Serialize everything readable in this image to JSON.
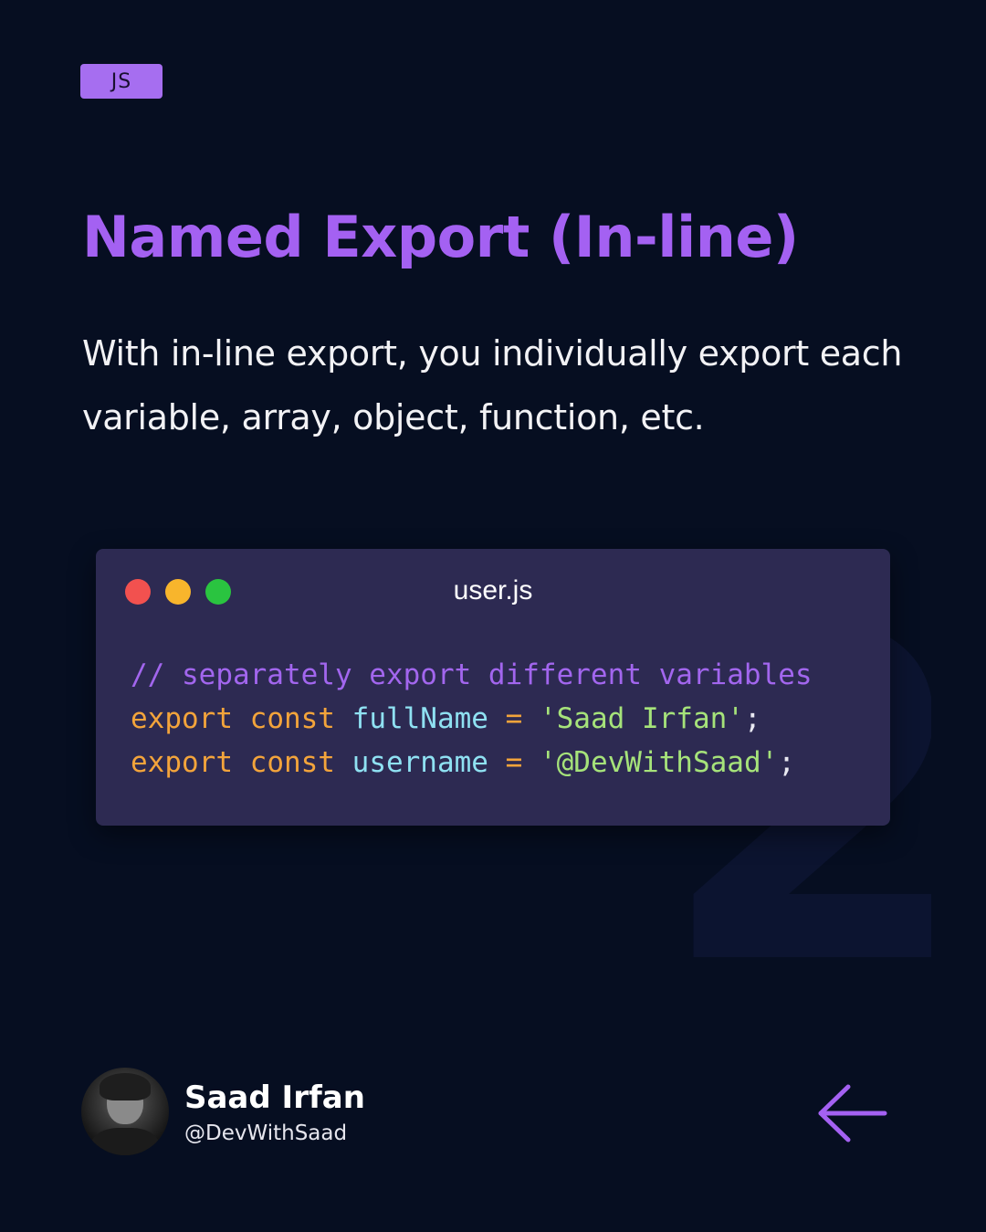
{
  "badge": {
    "label": "JS"
  },
  "title": "Named Export (In-line)",
  "description": "With in-line export, you individually export each variable, array, object, function, etc.",
  "background_number": "2",
  "code_window": {
    "filename": "user.js",
    "lines": {
      "line1": {
        "comment": "// separately export different variables"
      },
      "line2": {
        "kw_export": "export",
        "kw_const": "const",
        "identifier": "fullName",
        "operator": "=",
        "string": "'Saad Irfan'",
        "terminator": ";"
      },
      "line3": {
        "kw_export": "export",
        "kw_const": "const",
        "identifier": "username",
        "operator": "=",
        "string": "'@DevWithSaad'",
        "terminator": ";"
      }
    }
  },
  "author": {
    "name": "Saad Irfan",
    "handle": "@DevWithSaad"
  },
  "icons": {
    "back": "arrow-left-icon",
    "avatar": "avatar"
  },
  "colors": {
    "background": "#060e21",
    "accent": "#a461f2",
    "badge": "#a66ef0",
    "code_window": "#2d2a52",
    "window_red": "#f2514f",
    "window_yellow": "#f8b52c",
    "window_green": "#2ac440",
    "syntax_comment": "#a266ee",
    "syntax_keyword": "#f3a43b",
    "syntax_identifier": "#8fe1f2",
    "syntax_string": "#a6e37a"
  }
}
